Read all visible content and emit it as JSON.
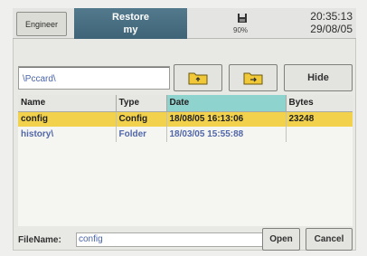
{
  "header": {
    "engineer_label": "Engineer",
    "restore_line1": "Restore",
    "restore_line2": "my",
    "battery": "90%",
    "time": "20:35:13",
    "date": "29/08/05",
    "disk_icon": "floppy-disk-icon"
  },
  "path": {
    "value": "\\Pccard\\"
  },
  "toolbar": {
    "folder_up_icon": "folder-up-icon",
    "folder_new_icon": "folder-open-icon",
    "hide_label": "Hide"
  },
  "table": {
    "columns": [
      "Name",
      "Type",
      "Date",
      "Bytes"
    ],
    "rows": [
      {
        "name": "config",
        "type": "Config",
        "date": "18/08/05 16:13:06",
        "bytes": "23248",
        "selected": true
      },
      {
        "name": "history\\",
        "type": "Folder",
        "date": "18/03/05 15:55:88",
        "bytes": "",
        "selected": false
      }
    ]
  },
  "footer": {
    "filename_label": "FileName:",
    "filename_value": "config",
    "open_label": "Open",
    "cancel_label": "Cancel"
  },
  "colors": {
    "selected_row": "#f2d24c",
    "sorted_column": "#8fd3cf",
    "title_bar": "#4a6e82",
    "link_text": "#5167a9"
  }
}
